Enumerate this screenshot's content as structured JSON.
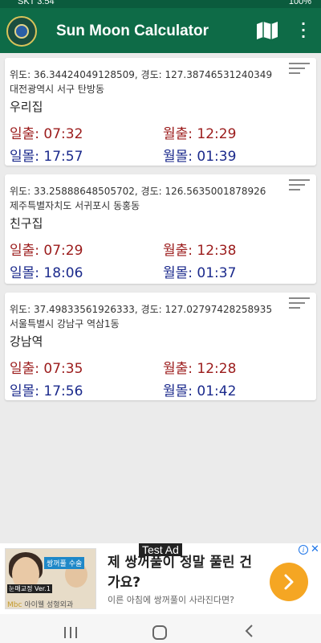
{
  "status_bar": {
    "left": "SKT 3:54",
    "right": "100%"
  },
  "app": {
    "title": "Sun Moon Calculator"
  },
  "locations": [
    {
      "coords": "위도: 36.34424049128509, 경도: 127.38746531240349",
      "address": "대전광역시 서구 탄방동",
      "name": "우리집",
      "sunrise": "일출: 07:32",
      "moonrise": "월출: 12:29",
      "sunset": "일몰: 17:57",
      "moonset": "월몰: 01:39"
    },
    {
      "coords": "위도: 33.25888648505702, 경도: 126.5635001878926",
      "address": "제주특별자치도 서귀포시 동홍동",
      "name": "친구집",
      "sunrise": "일출: 07:29",
      "moonrise": "월출: 12:38",
      "sunset": "일몰: 18:06",
      "moonset": "월몰: 01:37"
    },
    {
      "coords": "위도: 37.49833561926333, 경도: 127.02797428258935",
      "address": "서울특별시 강남구 역삼1동",
      "name": "강남역",
      "sunrise": "일출: 07:35",
      "moonrise": "월출: 12:28",
      "sunset": "일몰: 17:56",
      "moonset": "월몰: 01:42"
    }
  ],
  "ad": {
    "test_label": "Test Ad",
    "headline": "제 쌍꺼풀이 정말 풀린 건가요?",
    "subtext": "이른 아침에 쌍꺼풀이 사라진다면?",
    "image_banner": "쌍꺼풀 수술",
    "image_tag": "눈매교정 Ver.1",
    "sponsor_prefix": "Mbc",
    "sponsor_name": "아이웰 성형외과",
    "cta_icon": "arrow-right-icon",
    "info_icon": "i",
    "close_icon": "✕"
  },
  "colors": {
    "app_bar": "#0e6b47",
    "rise": "#9b1b1b",
    "set": "#1b2a8c",
    "cta": "#f5a623"
  }
}
